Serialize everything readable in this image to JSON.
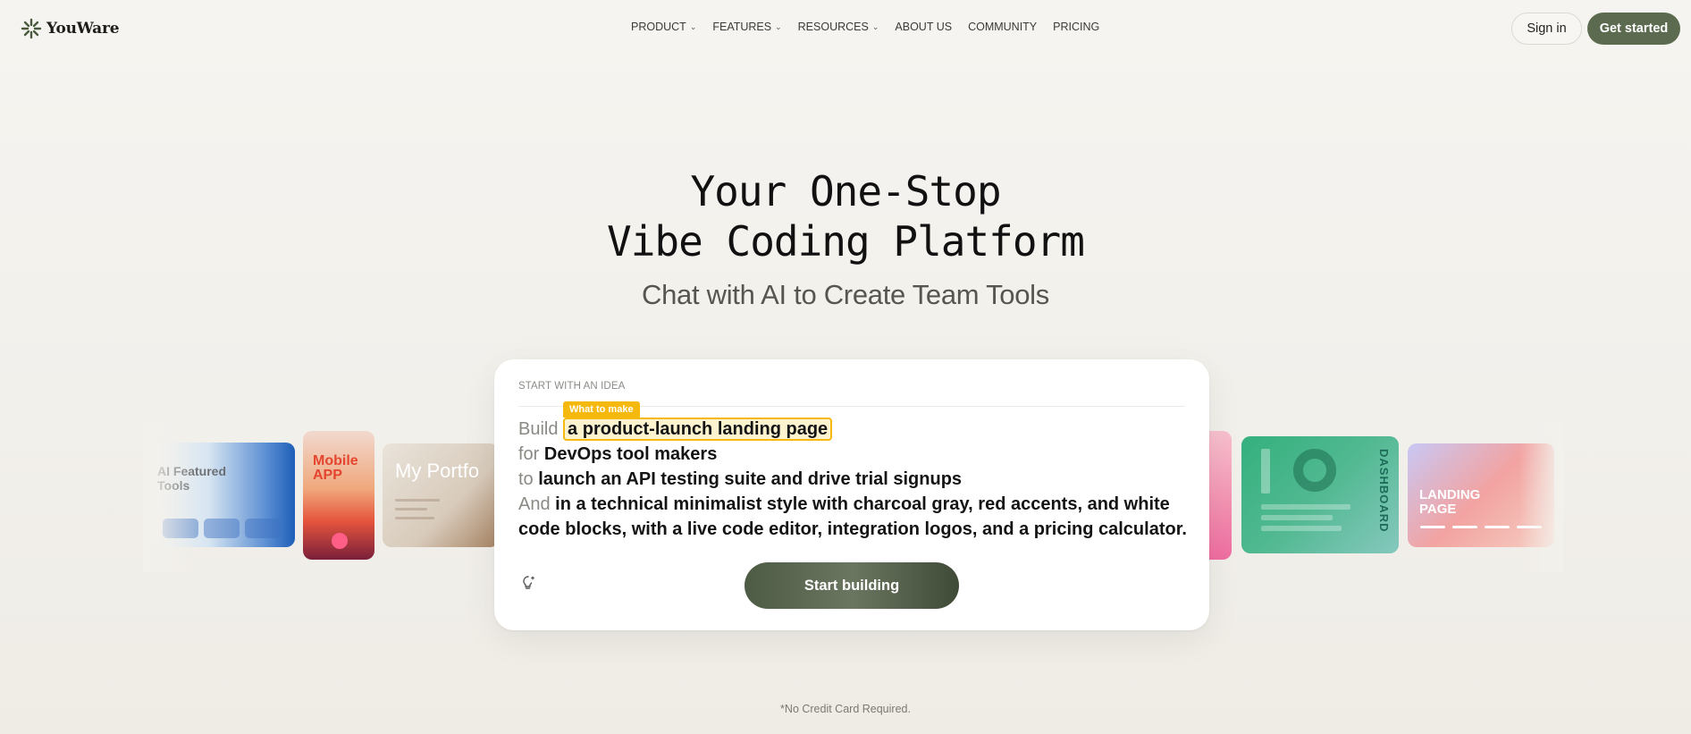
{
  "brand": {
    "name": "YouWare",
    "logo_icon": "asterisk-logo-icon",
    "accent": "#5c6b4f"
  },
  "nav": {
    "items": [
      {
        "label": "PRODUCT",
        "dropdown": true
      },
      {
        "label": "FEATURES",
        "dropdown": true
      },
      {
        "label": "RESOURCES",
        "dropdown": true
      },
      {
        "label": "ABOUT US",
        "dropdown": false
      },
      {
        "label": "COMMUNITY",
        "dropdown": false
      },
      {
        "label": "PRICING",
        "dropdown": false
      }
    ],
    "caret": "⌄",
    "sign_in": "Sign in",
    "get_started": "Get started"
  },
  "hero": {
    "title_line1": "Your One-Stop",
    "title_line2": "Vibe Coding Platform",
    "subtitle": "Chat with AI to Create Team Tools"
  },
  "showcase": {
    "cards": [
      {
        "label_line1": "AI Featured",
        "label_line2": "Tools"
      },
      {
        "label_line1": "Mobile",
        "label_line2": "APP"
      },
      {
        "label_line1": "My Portfo"
      },
      {
        "label_line1": "DASHBOARD"
      },
      {
        "label_line1": "LANDING",
        "label_line2": "PAGE"
      }
    ]
  },
  "prompt": {
    "section_label": "START WITH AN IDEA",
    "highlight_tag": "What to make",
    "lines": [
      {
        "keyword": "Build",
        "value": "a product-launch landing page"
      },
      {
        "keyword": "for",
        "value": "DevOps tool makers"
      },
      {
        "keyword": "to",
        "value": "launch an API testing suite and drive trial signups"
      },
      {
        "keyword": "And",
        "value": "in a technical minimalist style with charcoal gray, red accents, and white code blocks, with a live code editor, integration logos, and a pricing calculator."
      }
    ],
    "idea_icon": "lightbulb-sparkle-icon",
    "start_button": "Start building"
  },
  "footnote": "*No Credit Card Required."
}
